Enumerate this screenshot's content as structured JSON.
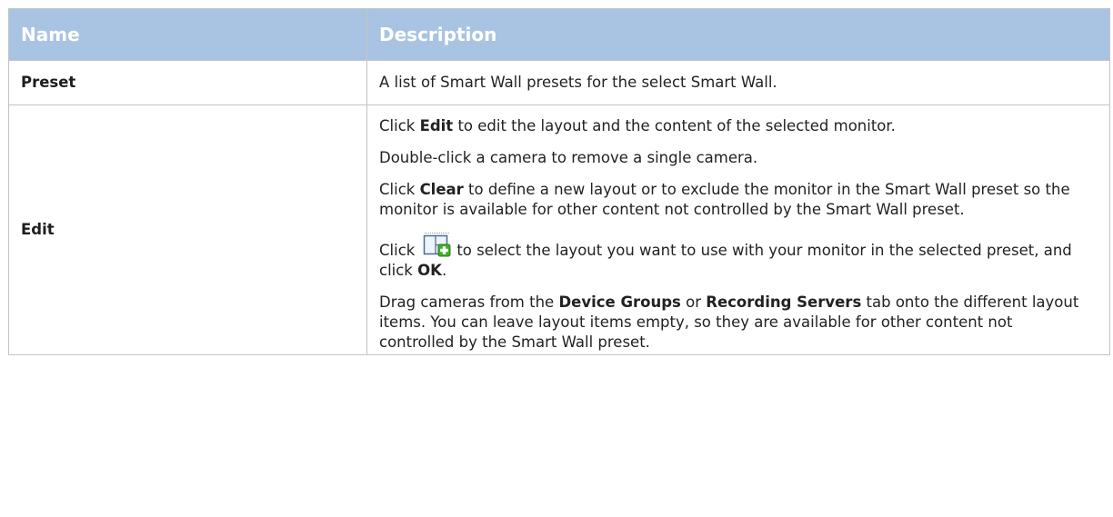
{
  "table": {
    "headers": {
      "name": "Name",
      "description": "Description"
    },
    "rows": {
      "preset": {
        "name": "Preset",
        "description": "A list of Smart Wall presets for the select Smart Wall."
      },
      "edit": {
        "name": "Edit",
        "p1": {
          "before": "Click ",
          "bold": "Edit",
          "after": " to edit the layout and the content of the selected monitor."
        },
        "p2": "Double-click a camera to remove a single camera.",
        "p3": {
          "before": "Click ",
          "bold": "Clear",
          "after": " to define a new layout or to exclude the monitor in the Smart Wall preset so the monitor is available for other content not controlled by the Smart Wall preset."
        },
        "p4": {
          "before": "Click",
          "icon": "layout-add-icon",
          "after": "to select the layout you want to use with your monitor in the selected preset, and click ",
          "bold": "OK",
          "end": "."
        },
        "p5": {
          "before": "Drag cameras from the ",
          "bold1": "Device Groups",
          "middle": " or ",
          "bold2": "Recording Servers",
          "after": " tab onto the different layout items. You can leave layout items empty, so they are available for other content not controlled by the Smart Wall preset."
        }
      }
    }
  },
  "colors": {
    "header_bg": "#a9c4e2",
    "header_text": "#ffffff",
    "border": "#c4c4c4",
    "icon_green": "#3fae2a"
  }
}
